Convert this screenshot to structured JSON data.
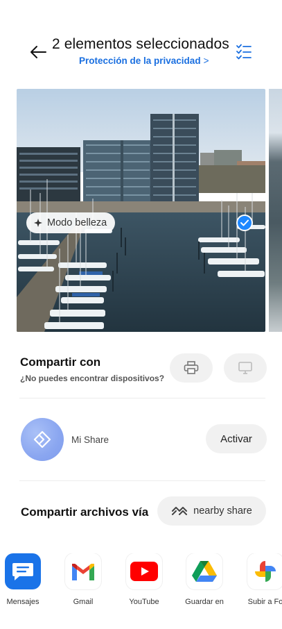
{
  "header": {
    "title": "2 elementos seleccionados",
    "privacy_link": "Protección de la privacidad",
    "privacy_chevron": ">"
  },
  "photo": {
    "beauty_mode_label": "Modo belleza",
    "selected": true
  },
  "share_with": {
    "title": "Compartir con",
    "subtitle": "¿No puedes encontrar dispositivos?",
    "devices": [
      "printer-icon",
      "monitor-icon"
    ]
  },
  "mishare": {
    "label": "Mi Share",
    "activate_label": "Activar"
  },
  "files_via": {
    "title": "Compartir archivos vía",
    "nearby_label": "nearby share"
  },
  "apps": [
    {
      "label": "Mensajes",
      "icon": "messages-icon"
    },
    {
      "label": "Gmail",
      "icon": "gmail-icon"
    },
    {
      "label": "YouTube",
      "icon": "youtube-icon"
    },
    {
      "label": "Guardar en",
      "icon": "google-drive-icon"
    },
    {
      "label": "Subir a Fo",
      "icon": "google-photos-icon"
    }
  ],
  "colors": {
    "accent": "#1a6fe0",
    "check": "#1e88ff",
    "pill_bg": "#f1f1f1"
  }
}
